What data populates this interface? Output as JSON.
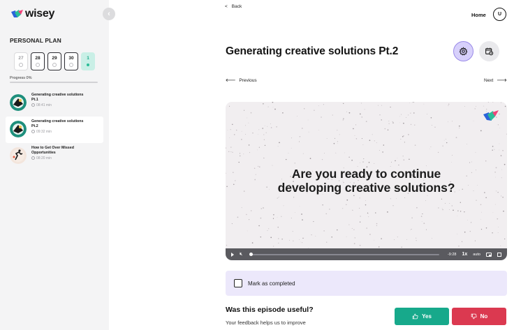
{
  "brand": {
    "name": "wisey"
  },
  "sidebar": {
    "plan_title": "PERSONAL PLAN",
    "days": [
      {
        "num": "27",
        "state": "past"
      },
      {
        "num": "28",
        "state": "active"
      },
      {
        "num": "29",
        "state": "active"
      },
      {
        "num": "30",
        "state": "active"
      },
      {
        "num": "1",
        "state": "today"
      }
    ],
    "progress_label": "Progress 0%",
    "progress_percent": 0,
    "episodes": [
      {
        "title": "Generating creative solutions Pt.1",
        "duration": "08:41 min",
        "current": false,
        "icon": "creative-thumbnail"
      },
      {
        "title": "Generating creative solutions Pt.2",
        "duration": "09:32 min",
        "current": true,
        "icon": "creative-thumbnail"
      },
      {
        "title": "How to Get Over Missed Opportunities",
        "duration": "08:20 min",
        "current": false,
        "icon": "runner-thumbnail"
      }
    ]
  },
  "header": {
    "back_label": "Back",
    "home_label": "Home",
    "avatar_initial": "U"
  },
  "main": {
    "title": "Generating creative solutions Pt.2",
    "prev_label": "Previous",
    "next_label": "Next",
    "video": {
      "headline_line1": "Are you ready to continue",
      "headline_line2": "developing creative solutions?",
      "time_remaining": "-9:28",
      "speed": "1x",
      "quality": "auto"
    },
    "mark_completed_label": "Mark as completed",
    "feedback": {
      "question": "Was this episode useful?",
      "subtitle": "Your feedback helps us to improve",
      "yes_label": "Yes",
      "no_label": "No"
    }
  },
  "colors": {
    "accent_purple": "#9a8ae8",
    "yes_green": "#17a98b",
    "no_red": "#db3950",
    "today_green": "#2bbd97"
  }
}
